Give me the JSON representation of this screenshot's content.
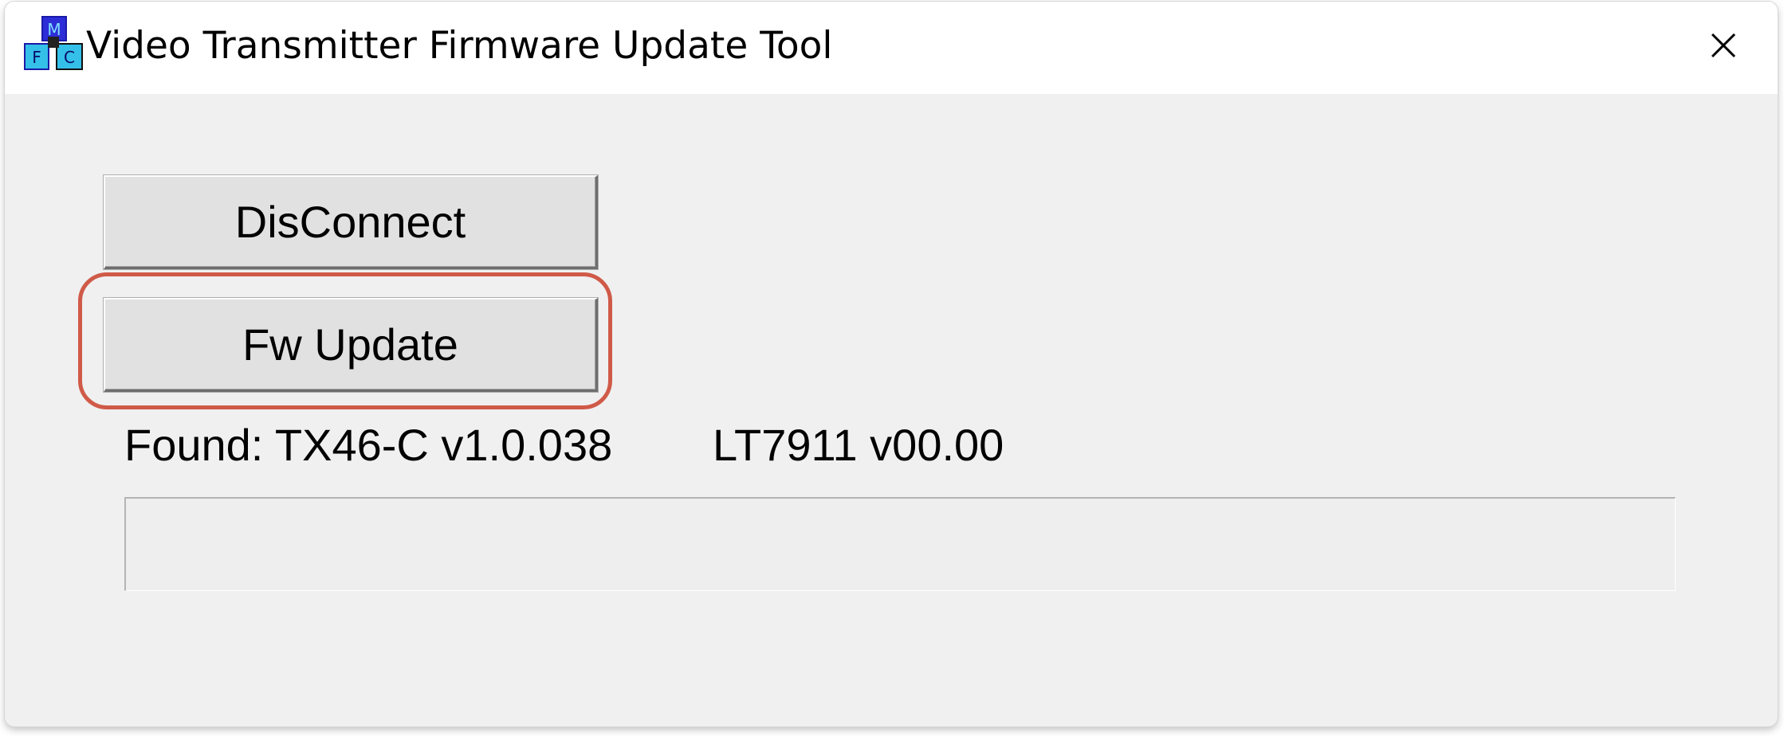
{
  "window": {
    "title": "Video Transmitter Firmware Update Tool",
    "app_icon": "cubes-app-icon",
    "close_icon": "close-icon"
  },
  "buttons": {
    "disconnect_label": "DisConnect",
    "fw_update_label": "Fw Update"
  },
  "status": {
    "found": "Found: TX46-C v1.0.038",
    "lt_version": "LT7911 v00.00"
  },
  "progress": {
    "value_percent": 0
  },
  "colors": {
    "highlight": "#d05a48",
    "window_bg": "#f0f0f0",
    "progress_fill": "#06b025"
  }
}
